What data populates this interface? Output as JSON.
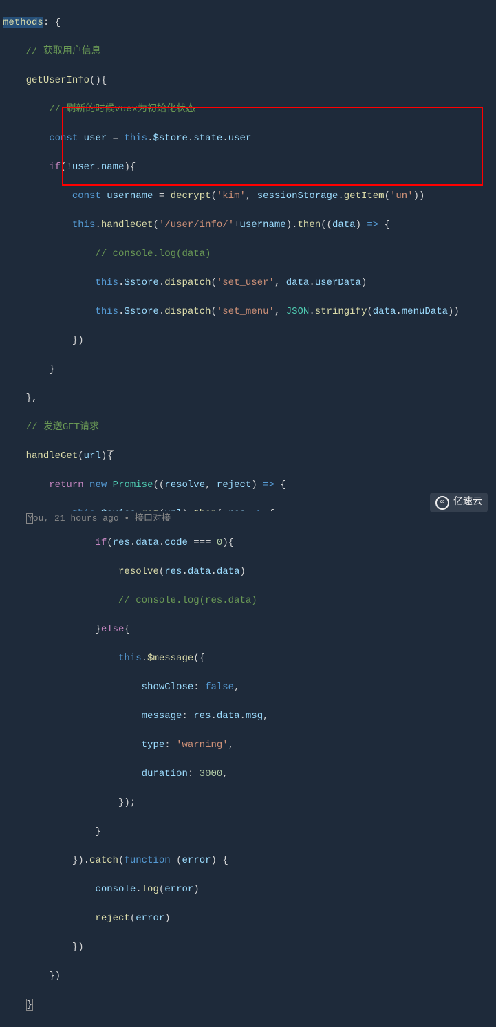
{
  "lines": {
    "l0": {
      "t0": "methods",
      "t1": ": {"
    },
    "l1": {
      "t0": "// 获取用户信息"
    },
    "l2": {
      "t0": "getUserInfo",
      "t1": "(){"
    },
    "l3": {
      "t0": "// 刷新的时候vuex为初始化状态"
    },
    "l4": {
      "t0": "const",
      "t1": " user",
      "t2": " = ",
      "t3": "this",
      "t4": ".",
      "t5": "$store",
      "t6": ".",
      "t7": "state",
      "t8": ".",
      "t9": "user"
    },
    "l5": {
      "t0": "if",
      "t1": "(!",
      "t2": "user",
      "t3": ".",
      "t4": "name",
      "t5": "){"
    },
    "l6": {
      "t0": "const",
      "t1": " username",
      "t2": " = ",
      "t3": "decrypt",
      "t4": "(",
      "t5": "'kim'",
      "t6": ", ",
      "t7": "sessionStorage",
      "t8": ".",
      "t9": "getItem",
      "t10": "(",
      "t11": "'un'",
      "t12": "))"
    },
    "l7": {
      "t0": "this",
      "t1": ".",
      "t2": "handleGet",
      "t3": "(",
      "t4": "'/user/info/'",
      "t5": "+",
      "t6": "username",
      "t7": ").",
      "t8": "then",
      "t9": "((",
      "t10": "data",
      "t11": ") ",
      "t12": "=>",
      "t13": " {"
    },
    "l8": {
      "t0": "// console.log(data)"
    },
    "l9": {
      "t0": "this",
      "t1": ".",
      "t2": "$store",
      "t3": ".",
      "t4": "dispatch",
      "t5": "(",
      "t6": "'set_user'",
      "t7": ", ",
      "t8": "data",
      "t9": ".",
      "t10": "userData",
      "t11": ")"
    },
    "l10": {
      "t0": "this",
      "t1": ".",
      "t2": "$store",
      "t3": ".",
      "t4": "dispatch",
      "t5": "(",
      "t6": "'set_menu'",
      "t7": ", ",
      "t8": "JSON",
      "t9": ".",
      "t10": "stringify",
      "t11": "(",
      "t12": "data",
      "t13": ".",
      "t14": "menuData",
      "t15": "))"
    },
    "l11": {
      "t0": "})"
    },
    "l12": {
      "t0": "}"
    },
    "l13": {
      "t0": "},"
    },
    "l14": {
      "t0": "// 发送GET请求"
    },
    "l15": {
      "t0": "handleGet",
      "t1": "(",
      "t2": "url",
      "t3": ")",
      "t4": "{"
    },
    "l16": {
      "t0": "return",
      "t1": " ",
      "t2": "new",
      "t3": " ",
      "t4": "Promise",
      "t5": "((",
      "t6": "resolve",
      "t7": ", ",
      "t8": "reject",
      "t9": ") ",
      "t10": "=>",
      "t11": " {"
    },
    "l17": {
      "t0": "this",
      "t1": ".",
      "t2": "$axios",
      "t3": ".",
      "t4": "get",
      "t5": "(",
      "t6": "url",
      "t7": ").",
      "t8": "then",
      "t9": "( ",
      "t10": "res",
      "t11": " ",
      "t12": "=>",
      "t13": " {"
    },
    "l18": {
      "t0": "if",
      "t1": "(",
      "t2": "res",
      "t3": ".",
      "t4": "data",
      "t5": ".",
      "t6": "code",
      "t7": " === ",
      "t8": "0",
      "t9": "){"
    },
    "l19": {
      "t0": "resolve",
      "t1": "(",
      "t2": "res",
      "t3": ".",
      "t4": "data",
      "t5": ".",
      "t6": "data",
      "t7": ")"
    },
    "l20": {
      "t0": "// console.log(res.data)"
    },
    "l21": {
      "t0": "}",
      "t1": "else",
      "t2": "{"
    },
    "l22": {
      "t0": "this",
      "t1": ".",
      "t2": "$message",
      "t3": "({"
    },
    "l23": {
      "t0": "showClose",
      "t1": ": ",
      "t2": "false",
      "t3": ","
    },
    "l24": {
      "t0": "message",
      "t1": ": ",
      "t2": "res",
      "t3": ".",
      "t4": "data",
      "t5": ".",
      "t6": "msg",
      "t7": ","
    },
    "l25": {
      "t0": "type",
      "t1": ": ",
      "t2": "'warning'",
      "t3": ","
    },
    "l26": {
      "t0": "duration",
      "t1": ": ",
      "t2": "3000",
      "t3": ","
    },
    "l27": {
      "t0": "});"
    },
    "l28": {
      "t0": "}"
    },
    "l29": {
      "t0": "}).",
      "t1": "catch",
      "t2": "(",
      "t3": "function",
      "t4": " (",
      "t5": "error",
      "t6": ") {"
    },
    "l30": {
      "t0": "console",
      "t1": ".",
      "t2": "log",
      "t3": "(",
      "t4": "error",
      "t5": ")"
    },
    "l31": {
      "t0": "reject",
      "t1": "(",
      "t2": "error",
      "t3": ")"
    },
    "l32": {
      "t0": "})"
    },
    "l33": {
      "t0": "})"
    },
    "l34": {
      "t0": "}"
    }
  },
  "status": {
    "blame": "You, 21 hours ago • 接口对接"
  },
  "watermark": {
    "text": "亿速云"
  }
}
